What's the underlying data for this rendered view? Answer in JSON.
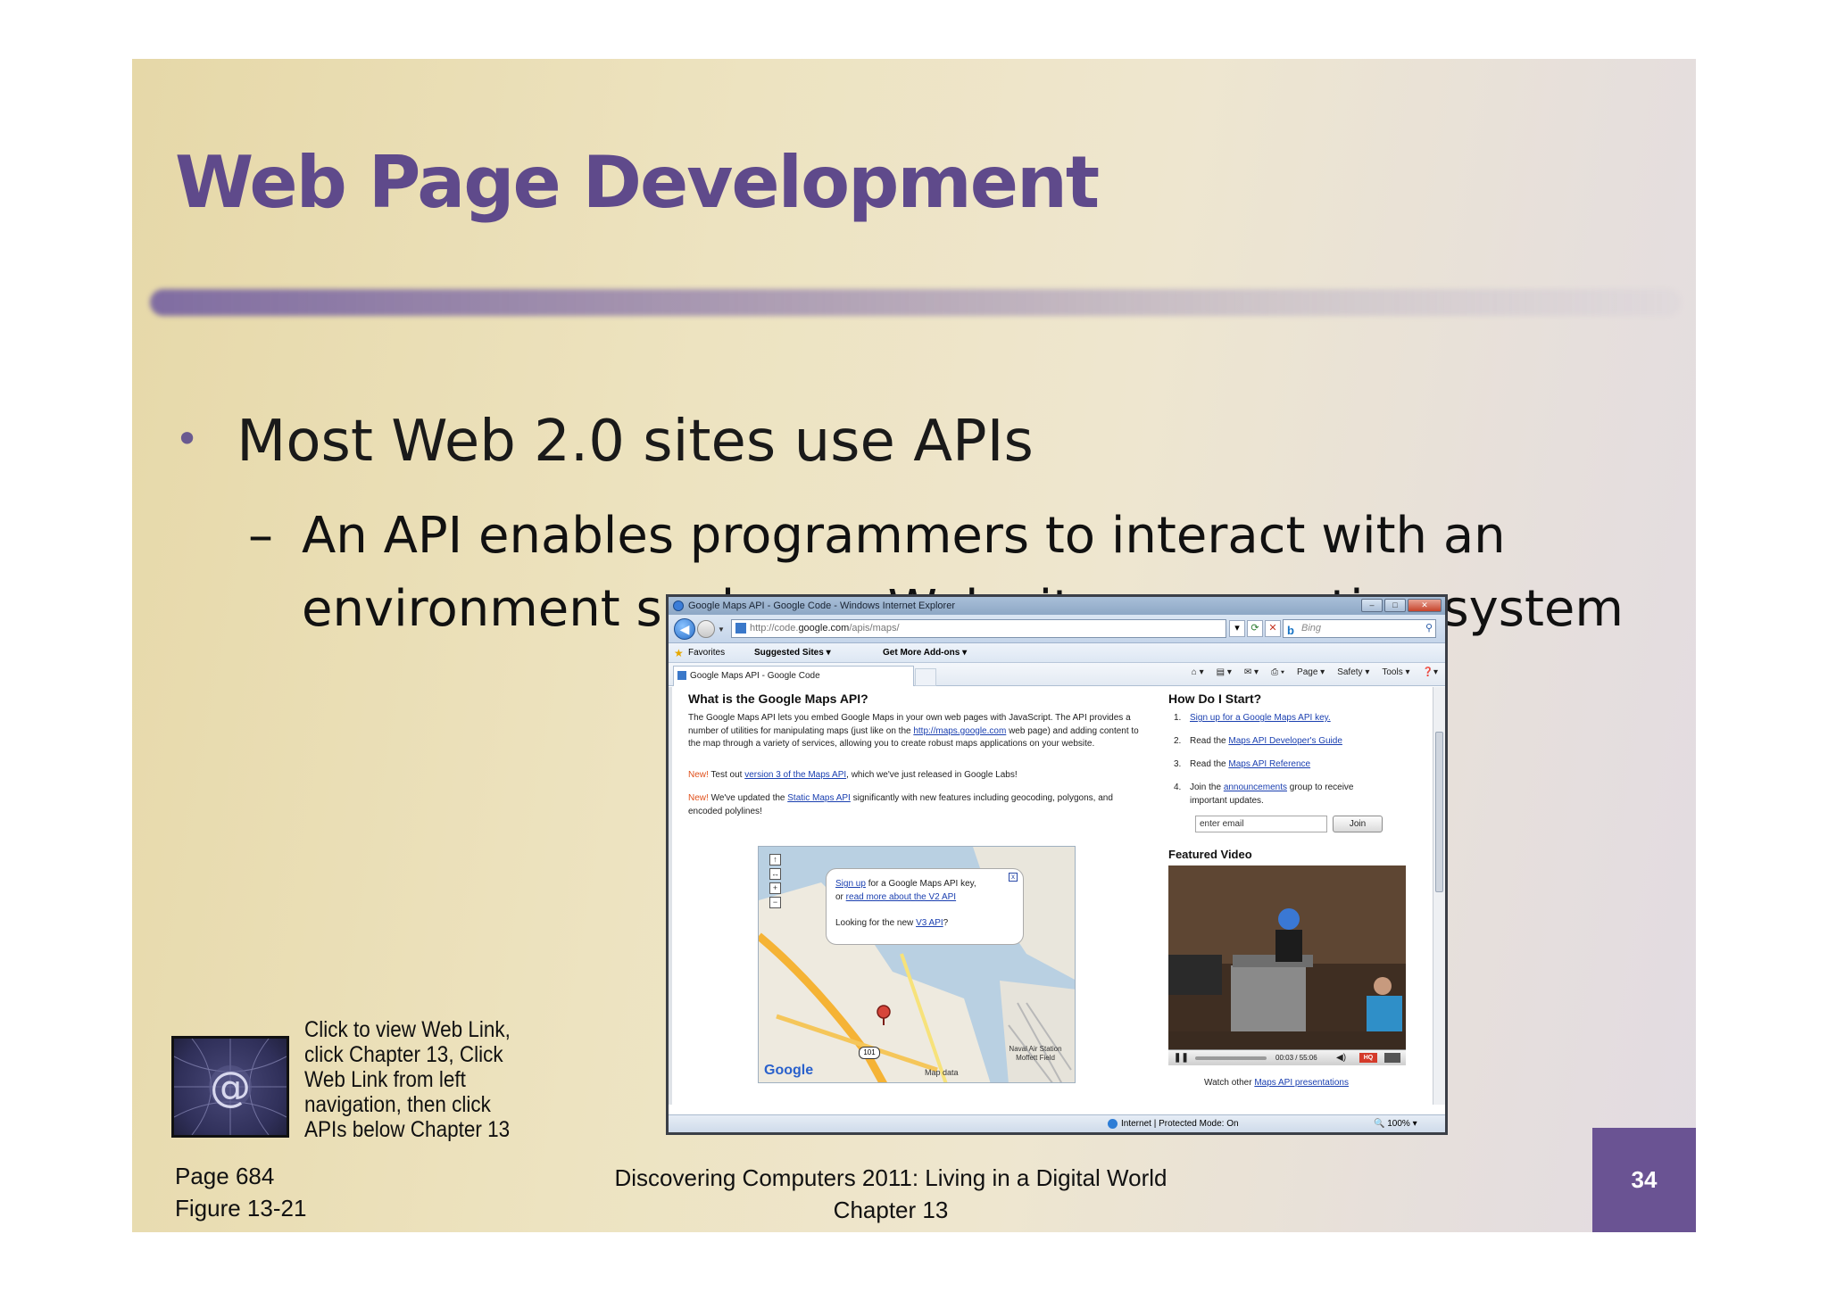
{
  "slide": {
    "title": "Web Page Development",
    "bullet": "Most Web 2.0 sites use APIs",
    "sub_dash": "–",
    "sub_bullet": "An API enables programmers to interact with an environment such as a Web site or operating system",
    "weblink_text": "Click to view Web Link, click Chapter 13, Click Web  Link from left navigation,  then click APIs below Chapter 13",
    "page_ref": "Page 684",
    "figure_ref": "Figure 13-21",
    "footer_line1": "Discovering Computers 2011: Living in a Digital World",
    "footer_line2": "Chapter 13",
    "page_number": "34",
    "colors": {
      "title": "#5f4a8b",
      "page_number_bg": "#6a5393"
    }
  },
  "browser": {
    "window_title": "Google Maps API - Google Code - Windows Internet Explorer",
    "url_prefix": "http://code.",
    "url_host": "google.com",
    "url_path": "/apis/maps/",
    "search_engine": "Bing",
    "favorites_label": "Favorites",
    "suggested_sites": "Suggested Sites ▾",
    "get_addons": "Get More Add-ons ▾",
    "tab_label": "Google Maps API - Google Code",
    "cmd_page": "Page ▾",
    "cmd_safety": "Safety ▾",
    "cmd_tools": "Tools ▾",
    "status_zone": "Internet | Protected Mode: On",
    "status_zoom": "100%"
  },
  "content": {
    "heading_left": "What is the Google Maps API?",
    "intro": "The Google Maps API lets you embed Google Maps in your own web pages with JavaScript. The API provides a number of utilities for manipulating maps (just like on the ",
    "intro_link": "http://maps.google.com",
    "intro_end": " web page) and adding content to the map through a variety of services, allowing you to create robust maps applications on your website.",
    "new1_tag": "New!",
    "new1_pre": " Test out ",
    "new1_link": "version 3 of the Maps API",
    "new1_post": ", which we've just released in Google Labs!",
    "new2_tag": "New!",
    "new2_pre": " We've updated the ",
    "new2_link": "Static Maps API",
    "new2_post": " significantly with new features including geocoding, polygons, and encoded polylines!",
    "heading_right": "How Do I Start?",
    "steps": [
      {
        "num": "1.",
        "pre": "",
        "link": "Sign up for a Google Maps API key.",
        "post": ""
      },
      {
        "num": "2.",
        "pre": "Read the ",
        "link": "Maps API Developer's Guide",
        "post": ""
      },
      {
        "num": "3.",
        "pre": "Read the ",
        "link": "Maps API Reference",
        "post": ""
      },
      {
        "num": "4.",
        "pre": "Join the ",
        "link": "announcements",
        "post": " group to receive important updates."
      }
    ],
    "email_placeholder": "enter email",
    "join_label": "Join",
    "featured_video": "Featured Video",
    "video_time": "00:03 / 55:06",
    "video_hq": "HQ",
    "watch_pre": "Watch other ",
    "watch_link": "Maps API presentations",
    "map": {
      "bubble_link1": "Sign up",
      "bubble_text1": " for a Google Maps API key,",
      "bubble_or": "or ",
      "bubble_link2": "read more about the V2 API",
      "bubble_text2": "Looking for the new ",
      "bubble_link3": "V3 API",
      "bubble_q": "?",
      "google_logo": "Google",
      "map_data": "Map data",
      "road": "101",
      "place1": "Naval Air Station Moffett Field"
    }
  }
}
